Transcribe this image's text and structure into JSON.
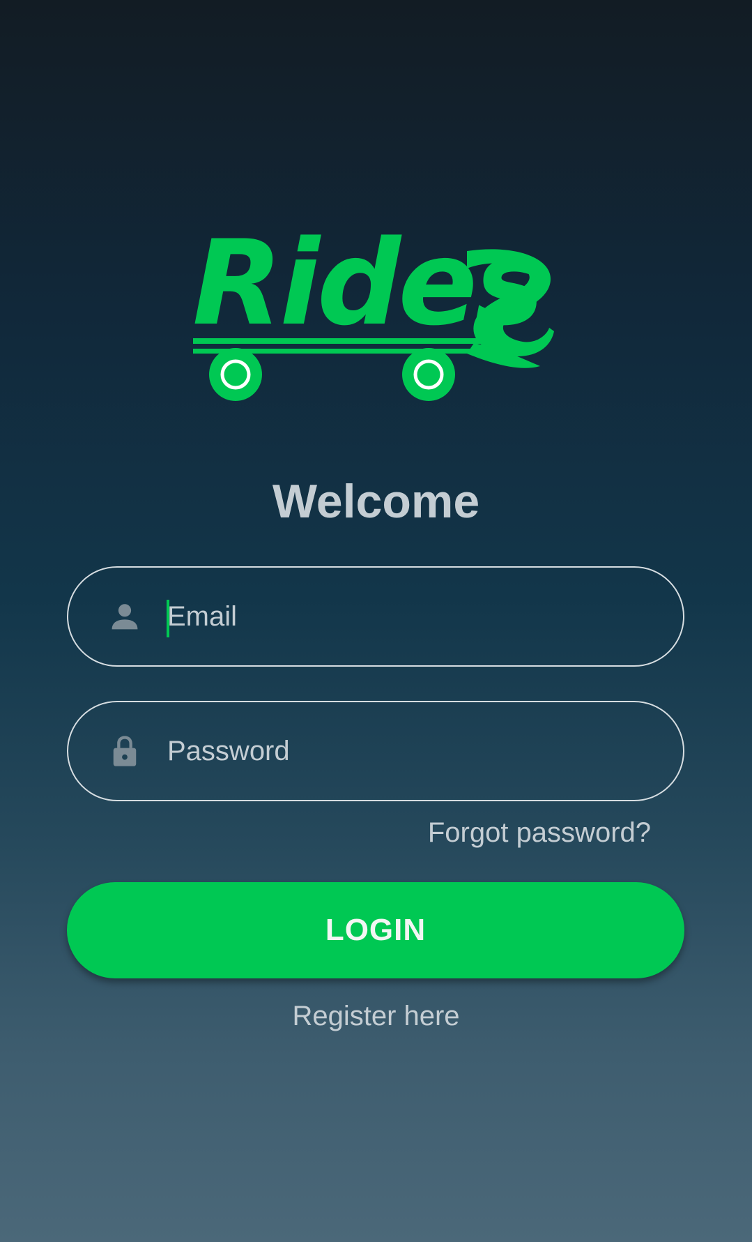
{
  "app": {
    "logo_text": "Rides",
    "brand_color": "#00c853",
    "logo_icon": "skateboard-wheels-icon"
  },
  "welcome": {
    "title": "Welcome"
  },
  "form": {
    "email": {
      "placeholder": "Email",
      "value": "",
      "icon": "person-icon"
    },
    "password": {
      "placeholder": "Password",
      "value": "",
      "icon": "lock-icon"
    },
    "forgot_label": "Forgot password?",
    "login_label": "LOGIN",
    "register_label": "Register here"
  },
  "colors": {
    "accent": "#00c853",
    "text": "#c4cdd3",
    "field_border": "#d6dde1",
    "icon": "#7b8b95"
  }
}
